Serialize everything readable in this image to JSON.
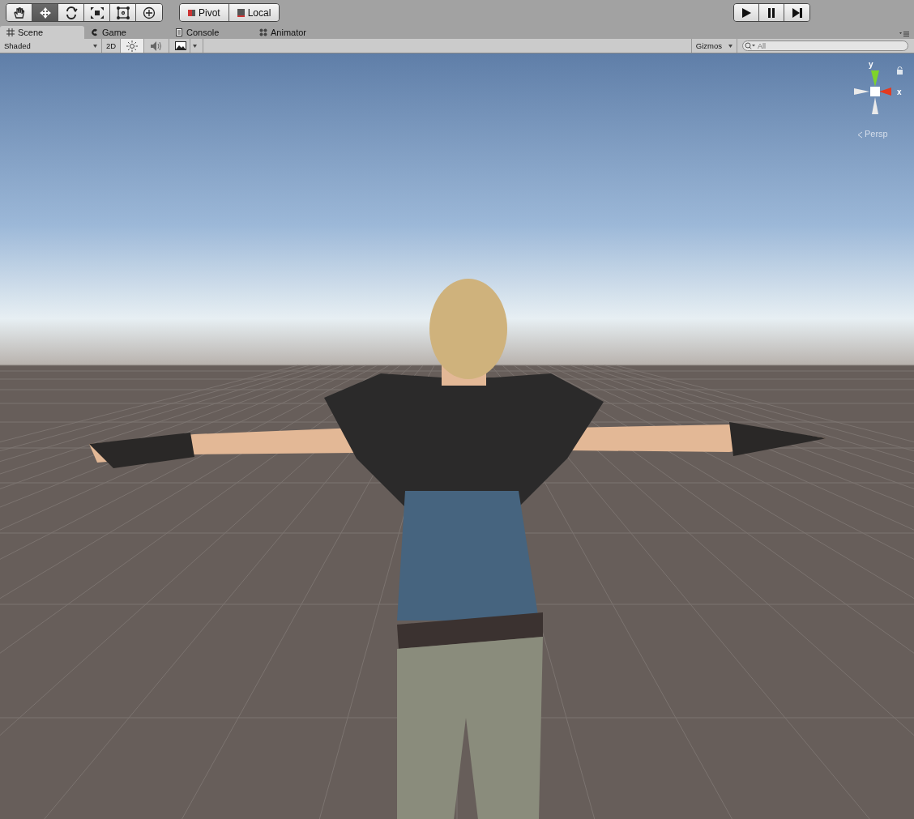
{
  "toolbar": {
    "tools": [
      {
        "kind": "hand",
        "selected": false
      },
      {
        "kind": "move",
        "selected": true
      },
      {
        "kind": "rotate",
        "selected": false
      },
      {
        "kind": "scale",
        "selected": false
      },
      {
        "kind": "rect",
        "selected": false
      },
      {
        "kind": "transform",
        "selected": false
      }
    ],
    "pivot": "Pivot",
    "local": "Local",
    "playback": [
      {
        "kind": "play",
        "selected": false
      },
      {
        "kind": "pause",
        "selected": false
      },
      {
        "kind": "step",
        "selected": false
      }
    ]
  },
  "tabs": [
    {
      "kind": "scene",
      "label": "Scene",
      "selected": true
    },
    {
      "kind": "game",
      "label": "Game",
      "selected": false
    },
    {
      "kind": "console",
      "label": "Console",
      "selected": false
    },
    {
      "kind": "animator",
      "label": "Animator",
      "selected": false
    }
  ],
  "scene_toolbar": {
    "draw_mode": "Shaded",
    "mode_2d": "2D",
    "lighting": {
      "on": true
    },
    "audio": {
      "on": false
    },
    "gizmos": "Gizmos",
    "search": {
      "placeholder": "All"
    }
  },
  "gizmo": {
    "y_label": "y",
    "x_label": "x",
    "projection": "Persp"
  }
}
